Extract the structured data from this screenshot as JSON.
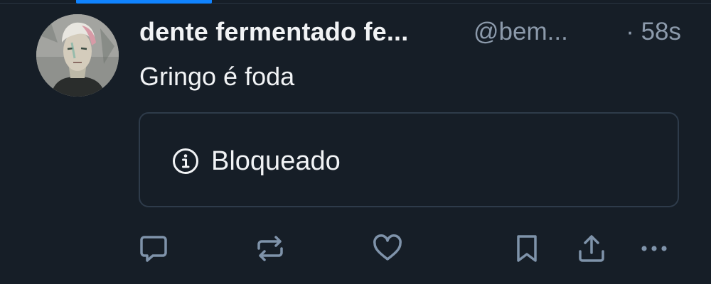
{
  "post": {
    "author": {
      "display_name": "dente fermentado fe...",
      "handle": "@bem...",
      "avatar_icon": "avatar-portrait"
    },
    "time": "· 58s",
    "text": "Gringo é foda",
    "embed": {
      "status_icon": "info-icon",
      "label": "Bloqueado"
    }
  },
  "actions": [
    {
      "name": "reply",
      "icon": "speech-bubble-icon"
    },
    {
      "name": "repost",
      "icon": "repost-arrows-icon"
    },
    {
      "name": "like",
      "icon": "heart-icon"
    },
    {
      "name": "bookmark",
      "icon": "bookmark-icon"
    },
    {
      "name": "share",
      "icon": "share-upload-icon"
    },
    {
      "name": "more",
      "icon": "ellipsis-icon"
    }
  ],
  "colors": {
    "background": "#161e27",
    "accent": "#1083fe",
    "text_primary": "#f1f3f5",
    "text_secondary": "#8c9aab",
    "icon": "#7f93aa",
    "border": "#2e3b4a"
  }
}
